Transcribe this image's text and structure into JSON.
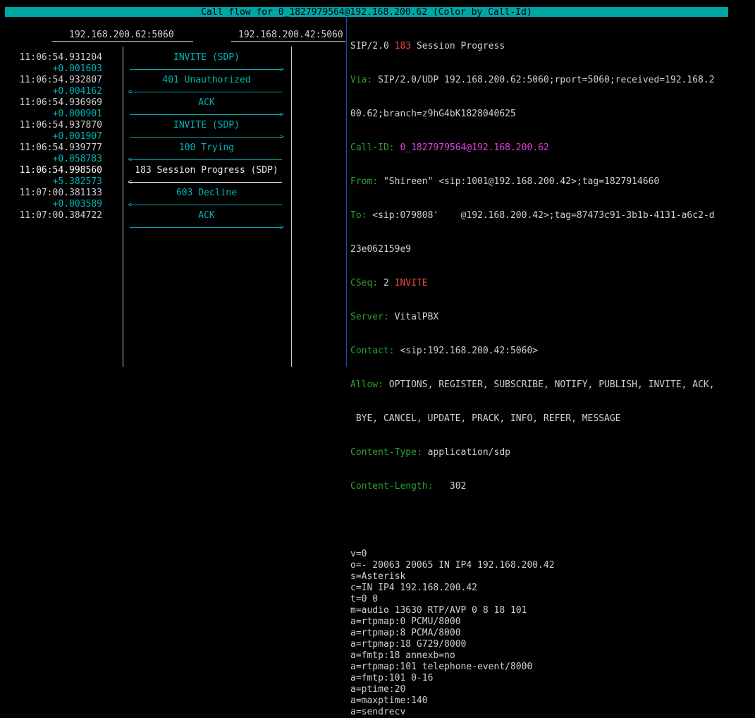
{
  "title": "Call flow for 0_1827979564@192.168.200.62 (Color by Call-Id)",
  "hosts": [
    "192.168.200.62:5060",
    "192.168.200.42:5060"
  ],
  "messages": [
    {
      "time": "11:06:54.931204",
      "delta": "+0.001603",
      "label": "INVITE (SDP)",
      "dir": "right",
      "selected": false
    },
    {
      "time": "11:06:54.932807",
      "delta": "+0.004162",
      "label": "401 Unauthorized",
      "dir": "left",
      "selected": false
    },
    {
      "time": "11:06:54.936969",
      "delta": "+0.000901",
      "label": "ACK",
      "dir": "right",
      "selected": false
    },
    {
      "time": "11:06:54.937870",
      "delta": "+0.001907",
      "label": "INVITE (SDP)",
      "dir": "right",
      "selected": false
    },
    {
      "time": "11:06:54.939777",
      "delta": "+0.058783",
      "label": "100 Trying",
      "dir": "left",
      "selected": false
    },
    {
      "time": "11:06:54.998560",
      "delta": "+5.382573",
      "label": "183 Session Progress (SDP)",
      "dir": "left",
      "selected": true
    },
    {
      "time": "11:07:00.381133",
      "delta": "+0.003589",
      "label": "603 Decline",
      "dir": "left",
      "selected": false
    },
    {
      "time": "11:07:00.384722",
      "delta": "",
      "label": "ACK",
      "dir": "right",
      "selected": false
    }
  ],
  "detail": {
    "status_prefix": "SIP/2.0 ",
    "status_code": "183",
    "status_text": " Session Progress",
    "via_key": "Via:",
    "via_val": " SIP/2.0/UDP 192.168.200.62:5060;rport=5060;received=192.168.2",
    "via_cont": "00.62;branch=z9hG4bK1828040625",
    "callid_key": "Call-ID:",
    "callid_val": " 0_1827979564@192.168.200.62",
    "from_key": "From:",
    "from_val": " \"Shireen\" <sip:1001@192.168.200.42>;tag=1827914660",
    "to_key": "To:",
    "to_val": " <sip:079808'    @192.168.200.42>;tag=87473c91-3b1b-4131-a6c2-d",
    "to_cont": "23e062159e9",
    "cseq_key": "CSeq:",
    "cseq_num": " 2 ",
    "cseq_method": "INVITE",
    "server_key": "Server:",
    "server_val": " VitalPBX",
    "contact_key": "Contact:",
    "contact_val": " <sip:192.168.200.42:5060>",
    "allow_key": "Allow:",
    "allow_val": " OPTIONS, REGISTER, SUBSCRIBE, NOTIFY, PUBLISH, INVITE, ACK,",
    "allow_cont": " BYE, CANCEL, UPDATE, PRACK, INFO, REFER, MESSAGE",
    "ctype_key": "Content-Type:",
    "ctype_val": " application/sdp",
    "clen_key": "Content-Length:",
    "clen_val": "   302",
    "sdp": [
      "v=0",
      "o=- 20063 20065 IN IP4 192.168.200.42",
      "s=Asterisk",
      "c=IN IP4 192.168.200.42",
      "t=0 0",
      "m=audio 13630 RTP/AVP 0 8 18 101",
      "a=rtpmap:0 PCMU/8000",
      "a=rtpmap:8 PCMA/8000",
      "a=rtpmap:18 G729/8000",
      "a=fmtp:18 annexb=no",
      "a=rtpmap:101 telephone-event/8000",
      "a=fmtp:101 0-16",
      "a=ptime:20",
      "a=maxptime:140",
      "a=sendrecv"
    ]
  },
  "colors": {
    "title_bg": "#00a6a6",
    "arrow": "#00a8a8",
    "header_key": "#2aa030",
    "status_code": "#e84a3a",
    "call_id": "#e040e0",
    "separator": "#1a4fb0"
  },
  "icons": {
    "right_arrowhead": "arrow-right-icon",
    "left_arrowhead": "arrow-left-icon"
  }
}
